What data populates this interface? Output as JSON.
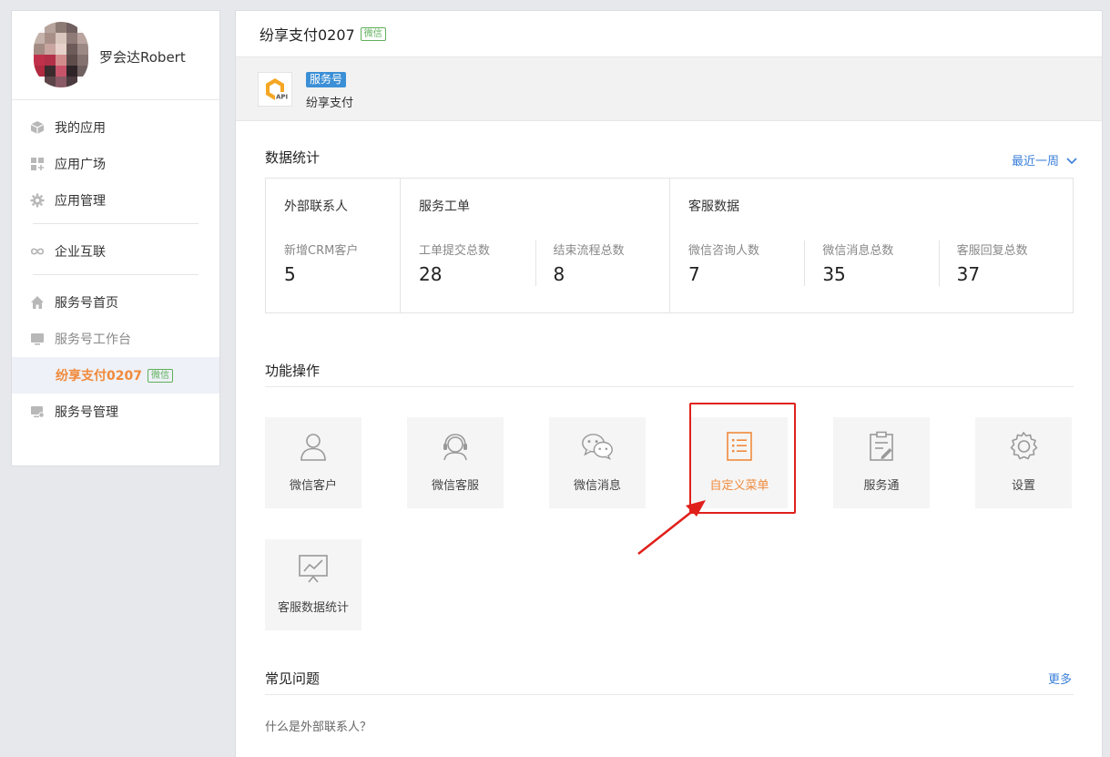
{
  "sidebar": {
    "user_name": "罗会达Robert",
    "items": [
      {
        "label": "我的应用"
      },
      {
        "label": "应用广场"
      },
      {
        "label": "应用管理"
      },
      {
        "label": "企业互联"
      },
      {
        "label": "服务号首页"
      },
      {
        "label": "服务号工作台"
      },
      {
        "label": "纷享支付0207",
        "tag": "微信"
      },
      {
        "label": "服务号管理"
      }
    ]
  },
  "header": {
    "title": "纷享支付0207",
    "tag": "微信"
  },
  "account": {
    "badge": "服务号",
    "name": "纷享支付",
    "logo_text": "API"
  },
  "stats": {
    "title": "数据统计",
    "range": "最近一周",
    "groups": [
      {
        "title": "外部联系人",
        "items": [
          {
            "label": "新增CRM客户",
            "value": "5"
          }
        ]
      },
      {
        "title": "服务工单",
        "items": [
          {
            "label": "工单提交总数",
            "value": "28"
          },
          {
            "label": "结束流程总数",
            "value": "8"
          }
        ]
      },
      {
        "title": "客服数据",
        "items": [
          {
            "label": "微信咨询人数",
            "value": "7"
          },
          {
            "label": "微信消息总数",
            "value": "35"
          },
          {
            "label": "客服回复总数",
            "value": "37"
          }
        ]
      }
    ]
  },
  "functions": {
    "title": "功能操作",
    "tiles": [
      {
        "label": "微信客户",
        "icon": "user-icon"
      },
      {
        "label": "微信客服",
        "icon": "headset-icon"
      },
      {
        "label": "微信消息",
        "icon": "wechat-icon"
      },
      {
        "label": "自定义菜单",
        "icon": "list-icon",
        "highlighted": true
      },
      {
        "label": "服务通",
        "icon": "clipboard-icon"
      },
      {
        "label": "设置",
        "icon": "gear-icon"
      },
      {
        "label": "客服数据统计",
        "icon": "chart-icon"
      }
    ]
  },
  "faq": {
    "title": "常见问题",
    "more": "更多",
    "items": [
      "什么是外部联系人？"
    ]
  },
  "colors": {
    "accent": "#f08a3c",
    "link": "#3b7fd9",
    "badge": "#3b8fd6",
    "wechat": "#5fb05b",
    "highlight": "#e0201b"
  }
}
